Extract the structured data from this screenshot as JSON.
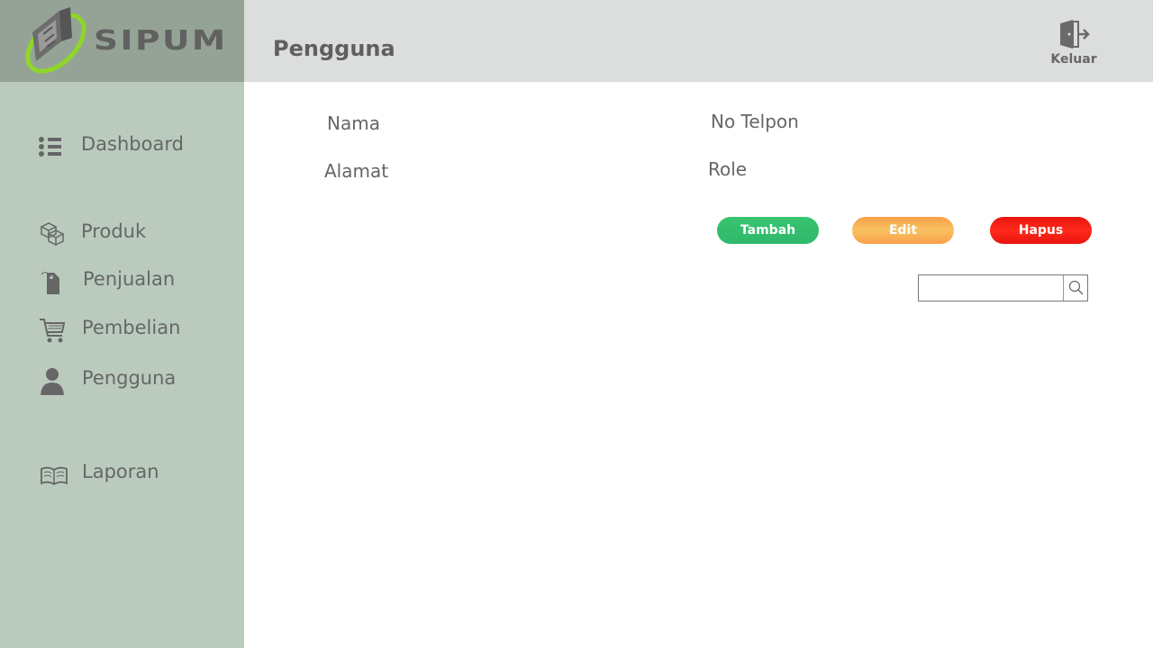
{
  "app": {
    "name": "SIPUM"
  },
  "header": {
    "title": "Pengguna",
    "logout_label": "Keluar"
  },
  "sidebar": {
    "items": [
      {
        "label": "Dashboard",
        "icon": "list-icon"
      },
      {
        "label": "Produk",
        "icon": "boxes-icon"
      },
      {
        "label": "Penjualan",
        "icon": "price-tag-icon"
      },
      {
        "label": "Pembelian",
        "icon": "shopping-cart-icon"
      },
      {
        "label": "Pengguna",
        "icon": "user-icon"
      },
      {
        "label": "Laporan",
        "icon": "open-book-icon"
      }
    ]
  },
  "form": {
    "fields": [
      {
        "label": "Nama"
      },
      {
        "label": "No Telpon"
      },
      {
        "label": "Alamat"
      },
      {
        "label": "Role"
      }
    ]
  },
  "actions": {
    "add": "Tambah",
    "edit": "Edit",
    "delete": "Hapus"
  },
  "search": {
    "value": "",
    "icon": "search-icon"
  },
  "colors": {
    "sidebar_bg": "#bacbbe",
    "logo_bg": "#95a396",
    "header_bg": "#dcdedd",
    "add": "#33be6d",
    "edit": "#f9ad52",
    "delete": "#f0180f",
    "logo_accent": "#8fd62a"
  }
}
